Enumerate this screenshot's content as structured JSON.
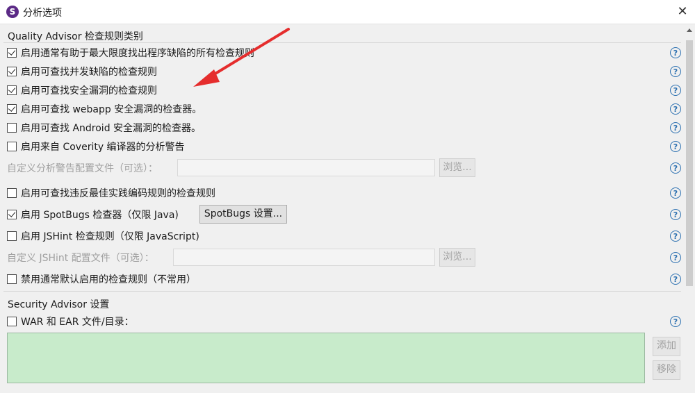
{
  "window": {
    "icon_letter": "S",
    "title": "分析选项",
    "close": "✕"
  },
  "quality": {
    "group_title": "Quality Advisor 检查规则类别",
    "items": [
      {
        "label": "启用通常有助于最大限度找出程序缺陷的所有检查规则",
        "checked": true
      },
      {
        "label": "启用可查找并发缺陷的检查规则",
        "checked": true
      },
      {
        "label": "启用可查找安全漏洞的检查规则",
        "checked": true
      },
      {
        "label": "启用可查找 webapp 安全漏洞的检查器。",
        "checked": true
      },
      {
        "label": "启用可查找 Android 安全漏洞的检查器。",
        "checked": false
      },
      {
        "label": "启用来自 Coverity 编译器的分析警告",
        "checked": false
      }
    ],
    "custom_warning_label": "自定义分析警告配置文件（可选）：",
    "browse_label": "浏览...",
    "best_practice_label": "启用可查找违反最佳实践编码规则的检查规则",
    "spotbugs_label": "启用 SpotBugs 检查器（仅限 Java)",
    "spotbugs_settings_label": "SpotBugs 设置...",
    "jshint_label": "启用 JSHint 检查规则（仅限 JavaScript)",
    "jshint_config_label": "自定义 JSHint 配置文件（可选）：",
    "jshint_browse_label": "浏览...",
    "disable_default_label": "禁用通常默认启用的检查规则（不常用）"
  },
  "security": {
    "group_title": "Security Advisor 设置",
    "war_label": "WAR 和 EAR 文件/目录：",
    "add_label": "添加",
    "remove_label": "移除"
  },
  "help_glyph": "?",
  "colors": {
    "arrow": "#e52d2d",
    "help": "#2a6fb0",
    "list_bg": "#c8ebcb"
  }
}
